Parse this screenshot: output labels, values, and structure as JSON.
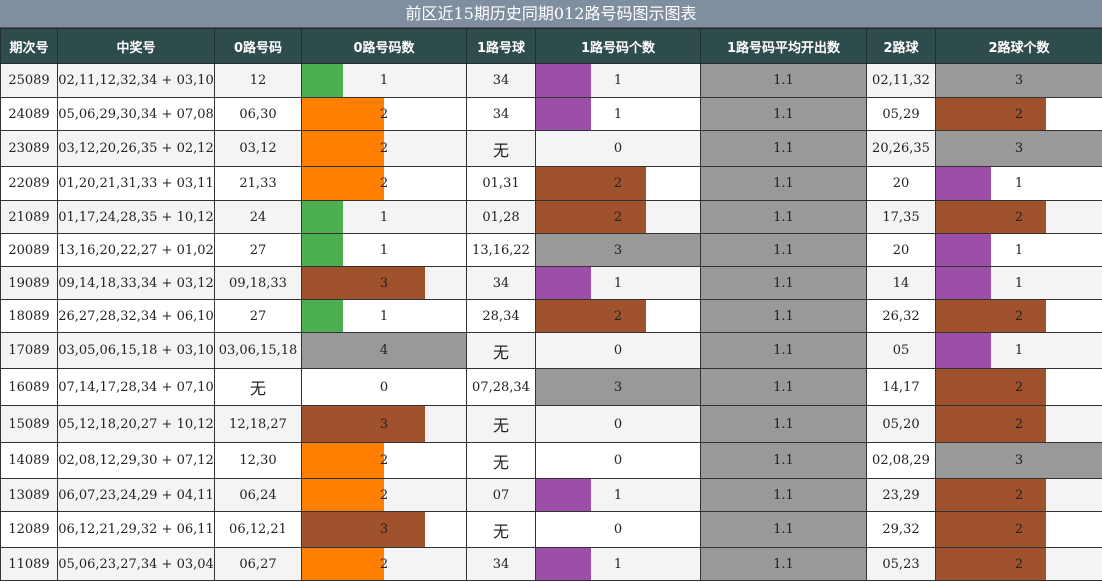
{
  "title": "前区近15期历史同期012路号码图示图表",
  "headers": [
    "期次号",
    "中奖号",
    "0路号码",
    "0路号码数",
    "1路号球",
    "1路号码个数",
    "1路号码平均开出数",
    "2路球",
    "2路球个数"
  ],
  "colors": {
    "1": "#4caf50",
    "2": "#ff8000",
    "3": "#a0522d",
    "4": "#999999",
    "1b": "#9b4fa8",
    "2b": "#a0522d",
    "3b": "#999999"
  },
  "rows": [
    {
      "issue": "25089",
      "numbers": "02,11,12,32,34 + 03,10",
      "zero": "12",
      "zero_count": "1",
      "one": "34",
      "one_count": "1",
      "one_avg": "1.1",
      "two": "02,11,32",
      "two_count": "3"
    },
    {
      "issue": "24089",
      "numbers": "05,06,29,30,34 + 07,08",
      "zero": "06,30",
      "zero_count": "2",
      "one": "34",
      "one_count": "1",
      "one_avg": "1.1",
      "two": "05,29",
      "two_count": "2"
    },
    {
      "issue": "23089",
      "numbers": "03,12,20,26,35 + 02,12",
      "zero": "03,12",
      "zero_count": "2",
      "one": "无",
      "one_count": "0",
      "one_avg": "1.1",
      "two": "20,26,35",
      "two_count": "3"
    },
    {
      "issue": "22089",
      "numbers": "01,20,21,31,33 + 03,11",
      "zero": "21,33",
      "zero_count": "2",
      "one": "01,31",
      "one_count": "2",
      "one_avg": "1.1",
      "two": "20",
      "two_count": "1"
    },
    {
      "issue": "21089",
      "numbers": "01,17,24,28,35 + 10,12",
      "zero": "24",
      "zero_count": "1",
      "one": "01,28",
      "one_count": "2",
      "one_avg": "1.1",
      "two": "17,35",
      "two_count": "2"
    },
    {
      "issue": "20089",
      "numbers": "13,16,20,22,27 + 01,02",
      "zero": "27",
      "zero_count": "1",
      "one": "13,16,22",
      "one_count": "3",
      "one_avg": "1.1",
      "two": "20",
      "two_count": "1"
    },
    {
      "issue": "19089",
      "numbers": "09,14,18,33,34 + 03,12",
      "zero": "09,18,33",
      "zero_count": "3",
      "one": "34",
      "one_count": "1",
      "one_avg": "1.1",
      "two": "14",
      "two_count": "1"
    },
    {
      "issue": "18089",
      "numbers": "26,27,28,32,34 + 06,10",
      "zero": "27",
      "zero_count": "1",
      "one": "28,34",
      "one_count": "2",
      "one_avg": "1.1",
      "two": "26,32",
      "two_count": "2"
    },
    {
      "issue": "17089",
      "numbers": "03,05,06,15,18 + 03,10",
      "zero": "03,06,15,18",
      "zero_count": "4",
      "one": "无",
      "one_count": "0",
      "one_avg": "1.1",
      "two": "05",
      "two_count": "1"
    },
    {
      "issue": "16089",
      "numbers": "07,14,17,28,34 + 07,10",
      "zero": "无",
      "zero_count": "0",
      "one": "07,28,34",
      "one_count": "3",
      "one_avg": "1.1",
      "two": "14,17",
      "two_count": "2"
    },
    {
      "issue": "15089",
      "numbers": "05,12,18,20,27 + 10,12",
      "zero": "12,18,27",
      "zero_count": "3",
      "one": "无",
      "one_count": "0",
      "one_avg": "1.1",
      "two": "05,20",
      "two_count": "2"
    },
    {
      "issue": "14089",
      "numbers": "02,08,12,29,30 + 07,12",
      "zero": "12,30",
      "zero_count": "2",
      "one": "无",
      "one_count": "0",
      "one_avg": "1.1",
      "two": "02,08,29",
      "two_count": "3"
    },
    {
      "issue": "13089",
      "numbers": "06,07,23,24,29 + 04,11",
      "zero": "06,24",
      "zero_count": "2",
      "one": "07",
      "one_count": "1",
      "one_avg": "1.1",
      "two": "23,29",
      "two_count": "2"
    },
    {
      "issue": "12089",
      "numbers": "06,12,21,29,32 + 06,11",
      "zero": "06,12,21",
      "zero_count": "3",
      "one": "无",
      "one_count": "0",
      "one_avg": "1.1",
      "two": "29,32",
      "two_count": "2"
    },
    {
      "issue": "11089",
      "numbers": "05,06,23,27,34 + 03,04",
      "zero": "06,27",
      "zero_count": "2",
      "one": "34",
      "one_count": "1",
      "one_avg": "1.1",
      "two": "05,23",
      "two_count": "2"
    }
  ]
}
